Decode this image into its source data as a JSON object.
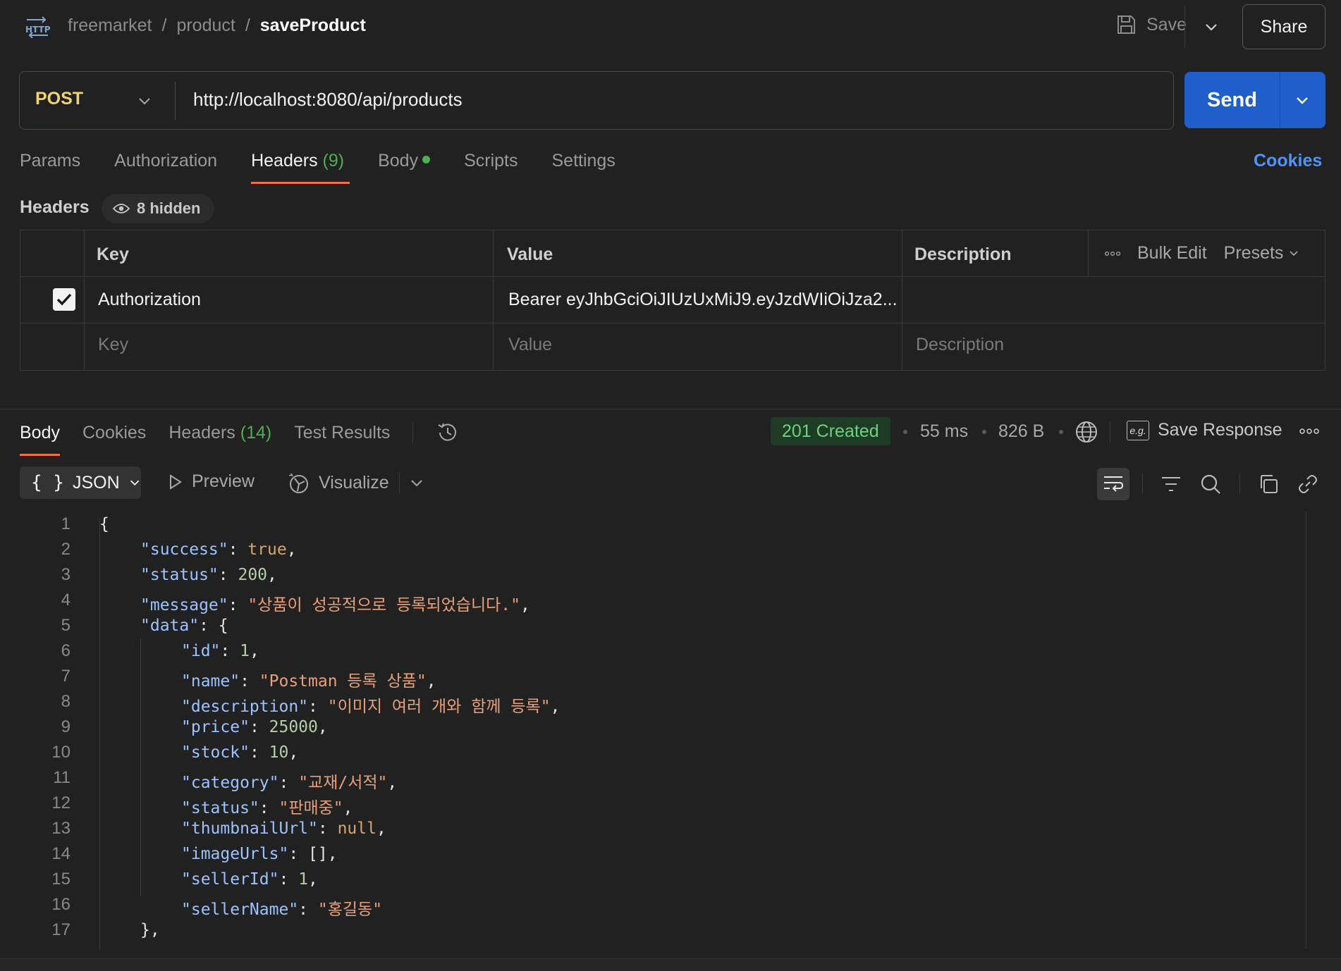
{
  "breadcrumb": {
    "workspace": "freemarket",
    "folder": "product",
    "request": "saveProduct",
    "sep": "/"
  },
  "toolbar": {
    "save_label": "Save",
    "share_label": "Share"
  },
  "request": {
    "method": "POST",
    "url": "http://localhost:8080/api/products",
    "send_label": "Send"
  },
  "tabs": {
    "params": "Params",
    "authorization": "Authorization",
    "headers": "Headers",
    "headers_count": "(9)",
    "body": "Body",
    "scripts": "Scripts",
    "settings": "Settings",
    "cookies": "Cookies"
  },
  "headers_section": {
    "title": "Headers",
    "hidden_label": "8 hidden",
    "columns": {
      "key": "Key",
      "value": "Value",
      "description": "Description"
    },
    "bulk_edit": "Bulk Edit",
    "presets": "Presets",
    "rows": [
      {
        "checked": true,
        "key": "Authorization",
        "value": "Bearer eyJhbGciOiJIUzUxMiJ9.eyJzdWIiOiJza2...",
        "description": ""
      }
    ],
    "placeholders": {
      "key": "Key",
      "value": "Value",
      "description": "Description"
    }
  },
  "response": {
    "tabs": {
      "body": "Body",
      "cookies": "Cookies",
      "headers": "Headers",
      "headers_count": "(14)",
      "test_results": "Test Results"
    },
    "status": "201 Created",
    "time": "55 ms",
    "size": "826 B",
    "save_response": "Save Response",
    "eg_label": "e.g.",
    "format": "JSON",
    "preview": "Preview",
    "visualize": "Visualize"
  },
  "code_lines": [
    {
      "n": "1",
      "indent": 0,
      "parts": [
        [
          "p",
          "{"
        ]
      ]
    },
    {
      "n": "2",
      "indent": 1,
      "parts": [
        [
          "k",
          "\"success\""
        ],
        [
          "p",
          ": "
        ],
        [
          "b",
          "true"
        ],
        [
          "p",
          ","
        ]
      ]
    },
    {
      "n": "3",
      "indent": 1,
      "parts": [
        [
          "k",
          "\"status\""
        ],
        [
          "p",
          ": "
        ],
        [
          "n",
          "200"
        ],
        [
          "p",
          ","
        ]
      ]
    },
    {
      "n": "4",
      "indent": 1,
      "parts": [
        [
          "k",
          "\"message\""
        ],
        [
          "p",
          ": "
        ],
        [
          "s",
          "\"상품이 성공적으로 등록되었습니다.\""
        ],
        [
          "p",
          ","
        ]
      ]
    },
    {
      "n": "5",
      "indent": 1,
      "parts": [
        [
          "k",
          "\"data\""
        ],
        [
          "p",
          ": {"
        ]
      ]
    },
    {
      "n": "6",
      "indent": 2,
      "parts": [
        [
          "k",
          "\"id\""
        ],
        [
          "p",
          ": "
        ],
        [
          "n",
          "1"
        ],
        [
          "p",
          ","
        ]
      ]
    },
    {
      "n": "7",
      "indent": 2,
      "parts": [
        [
          "k",
          "\"name\""
        ],
        [
          "p",
          ": "
        ],
        [
          "s",
          "\"Postman 등록 상품\""
        ],
        [
          "p",
          ","
        ]
      ]
    },
    {
      "n": "8",
      "indent": 2,
      "parts": [
        [
          "k",
          "\"description\""
        ],
        [
          "p",
          ": "
        ],
        [
          "s",
          "\"이미지 여러 개와 함께 등록\""
        ],
        [
          "p",
          ","
        ]
      ]
    },
    {
      "n": "9",
      "indent": 2,
      "parts": [
        [
          "k",
          "\"price\""
        ],
        [
          "p",
          ": "
        ],
        [
          "n",
          "25000"
        ],
        [
          "p",
          ","
        ]
      ]
    },
    {
      "n": "10",
      "indent": 2,
      "parts": [
        [
          "k",
          "\"stock\""
        ],
        [
          "p",
          ": "
        ],
        [
          "n",
          "10"
        ],
        [
          "p",
          ","
        ]
      ]
    },
    {
      "n": "11",
      "indent": 2,
      "parts": [
        [
          "k",
          "\"category\""
        ],
        [
          "p",
          ": "
        ],
        [
          "s",
          "\"교재/서적\""
        ],
        [
          "p",
          ","
        ]
      ]
    },
    {
      "n": "12",
      "indent": 2,
      "parts": [
        [
          "k",
          "\"status\""
        ],
        [
          "p",
          ": "
        ],
        [
          "s",
          "\"판매중\""
        ],
        [
          "p",
          ","
        ]
      ]
    },
    {
      "n": "13",
      "indent": 2,
      "parts": [
        [
          "k",
          "\"thumbnailUrl\""
        ],
        [
          "p",
          ": "
        ],
        [
          "b",
          "null"
        ],
        [
          "p",
          ","
        ]
      ]
    },
    {
      "n": "14",
      "indent": 2,
      "parts": [
        [
          "k",
          "\"imageUrls\""
        ],
        [
          "p",
          ": [],"
        ]
      ]
    },
    {
      "n": "15",
      "indent": 2,
      "parts": [
        [
          "k",
          "\"sellerId\""
        ],
        [
          "p",
          ": "
        ],
        [
          "n",
          "1"
        ],
        [
          "p",
          ","
        ]
      ]
    },
    {
      "n": "16",
      "indent": 2,
      "parts": [
        [
          "k",
          "\"sellerName\""
        ],
        [
          "p",
          ": "
        ],
        [
          "s",
          "\"홍길동\""
        ]
      ]
    },
    {
      "n": "17",
      "indent": 1,
      "parts": [
        [
          "p",
          "},"
        ]
      ]
    }
  ],
  "colors": {
    "accent": "#ff6c37",
    "send": "#1f5fcc",
    "method": "#f3d36c",
    "status_ok": "#6fd17e",
    "link": "#4f93ff"
  }
}
